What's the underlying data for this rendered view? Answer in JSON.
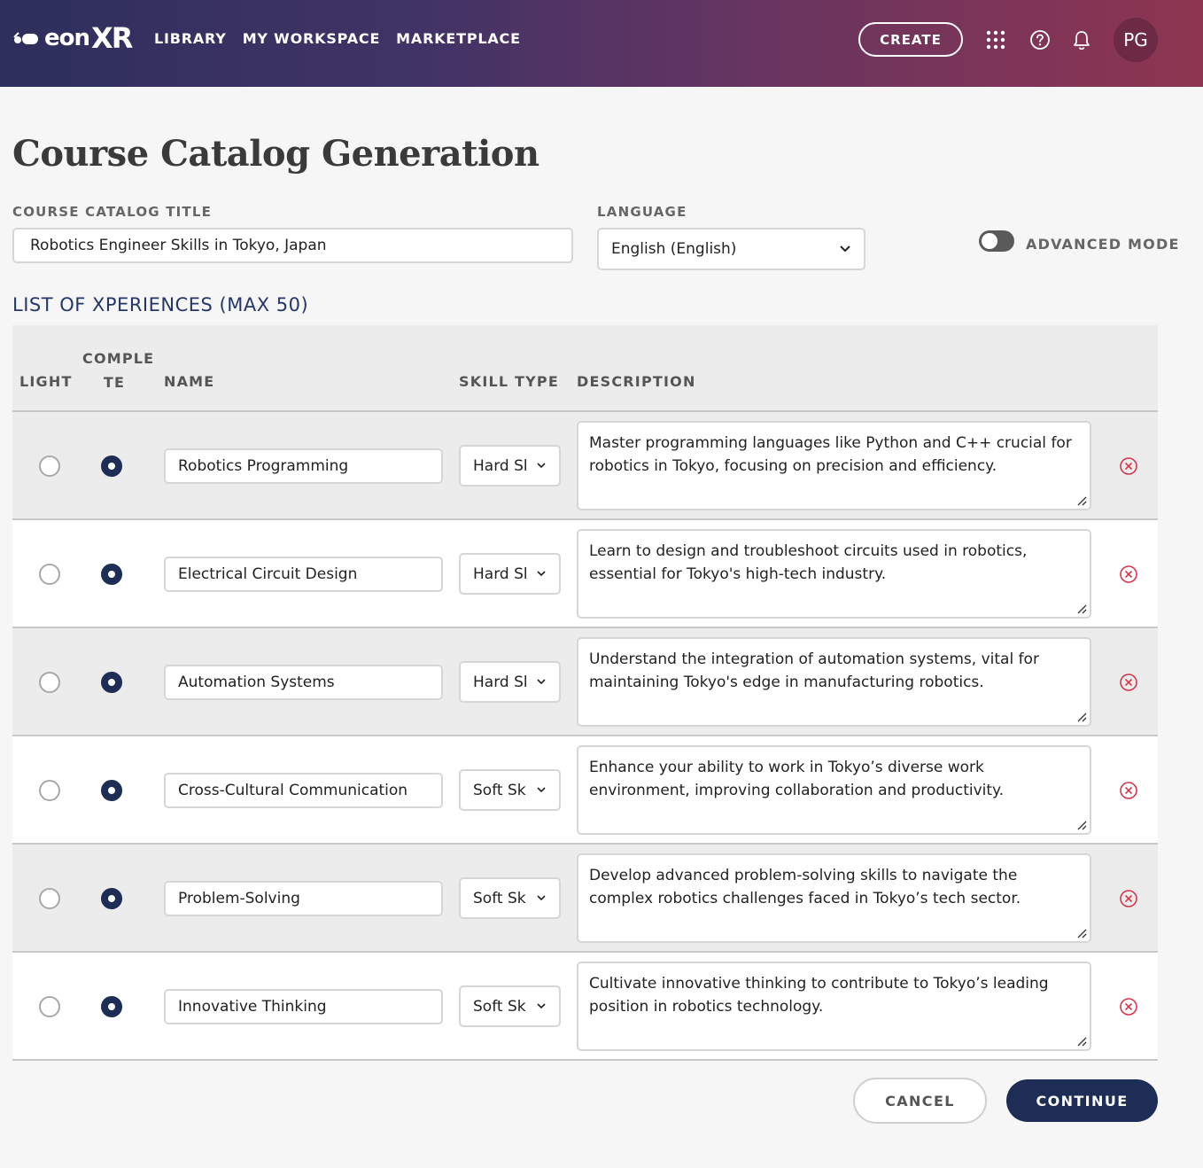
{
  "header": {
    "logo_text": "eon",
    "logo_xr": "XR",
    "nav": [
      "LIBRARY",
      "MY WORKSPACE",
      "MARKETPLACE"
    ],
    "create_label": "CREATE",
    "avatar_initials": "PG",
    "icons": [
      "apps-grid-icon",
      "help-icon",
      "bell-icon"
    ]
  },
  "page": {
    "title": "Course Catalog Generation",
    "catalog_title_label": "COURSE CATALOG TITLE",
    "catalog_title_value": "Robotics Engineer Skills in Tokyo, Japan",
    "language_label": "LANGUAGE",
    "language_value": "English (English)",
    "advanced_mode_label": "ADVANCED MODE",
    "advanced_mode_on": false,
    "list_title": "LIST OF XPERIENCES (MAX 50)"
  },
  "table": {
    "columns": {
      "light": "LIGHT",
      "complete_1": "COMPLE",
      "complete_2": "TE",
      "name": "NAME",
      "skill_type": "SKILL TYPE",
      "description": "DESCRIPTION"
    },
    "rows": [
      {
        "name": "Robotics Programming",
        "skill": "Hard Skill",
        "selected": "complete",
        "description": "Master programming languages like Python and C++ crucial for robotics in Tokyo, focusing on precision and efficiency."
      },
      {
        "name": "Electrical Circuit Design",
        "skill": "Hard Skill",
        "selected": "complete",
        "description": "Learn to design and troubleshoot circuits used in robotics, essential for Tokyo's high-tech industry."
      },
      {
        "name": "Automation Systems",
        "skill": "Hard Skill",
        "selected": "complete",
        "description": "Understand the integration of automation systems, vital for maintaining Tokyo's edge in manufacturing robotics."
      },
      {
        "name": "Cross-Cultural Communication",
        "skill": "Soft Skill",
        "selected": "complete",
        "description": "Enhance your ability to work in Tokyo’s diverse work environment, improving collaboration and productivity."
      },
      {
        "name": "Problem-Solving",
        "skill": "Soft Skill",
        "selected": "complete",
        "description": "Develop advanced problem-solving skills to navigate the complex robotics challenges faced in Tokyo’s tech sector."
      },
      {
        "name": "Innovative Thinking",
        "skill": "Soft Skill",
        "selected": "complete",
        "description": "Cultivate innovative thinking to contribute to Tokyo’s leading position in robotics technology."
      }
    ]
  },
  "actions": {
    "cancel": "CANCEL",
    "continue": "CONTINUE"
  },
  "colors": {
    "primary": "#1e2d55",
    "header_start": "#2d2f5c",
    "header_end": "#8e3550",
    "remove": "#d9364c"
  }
}
